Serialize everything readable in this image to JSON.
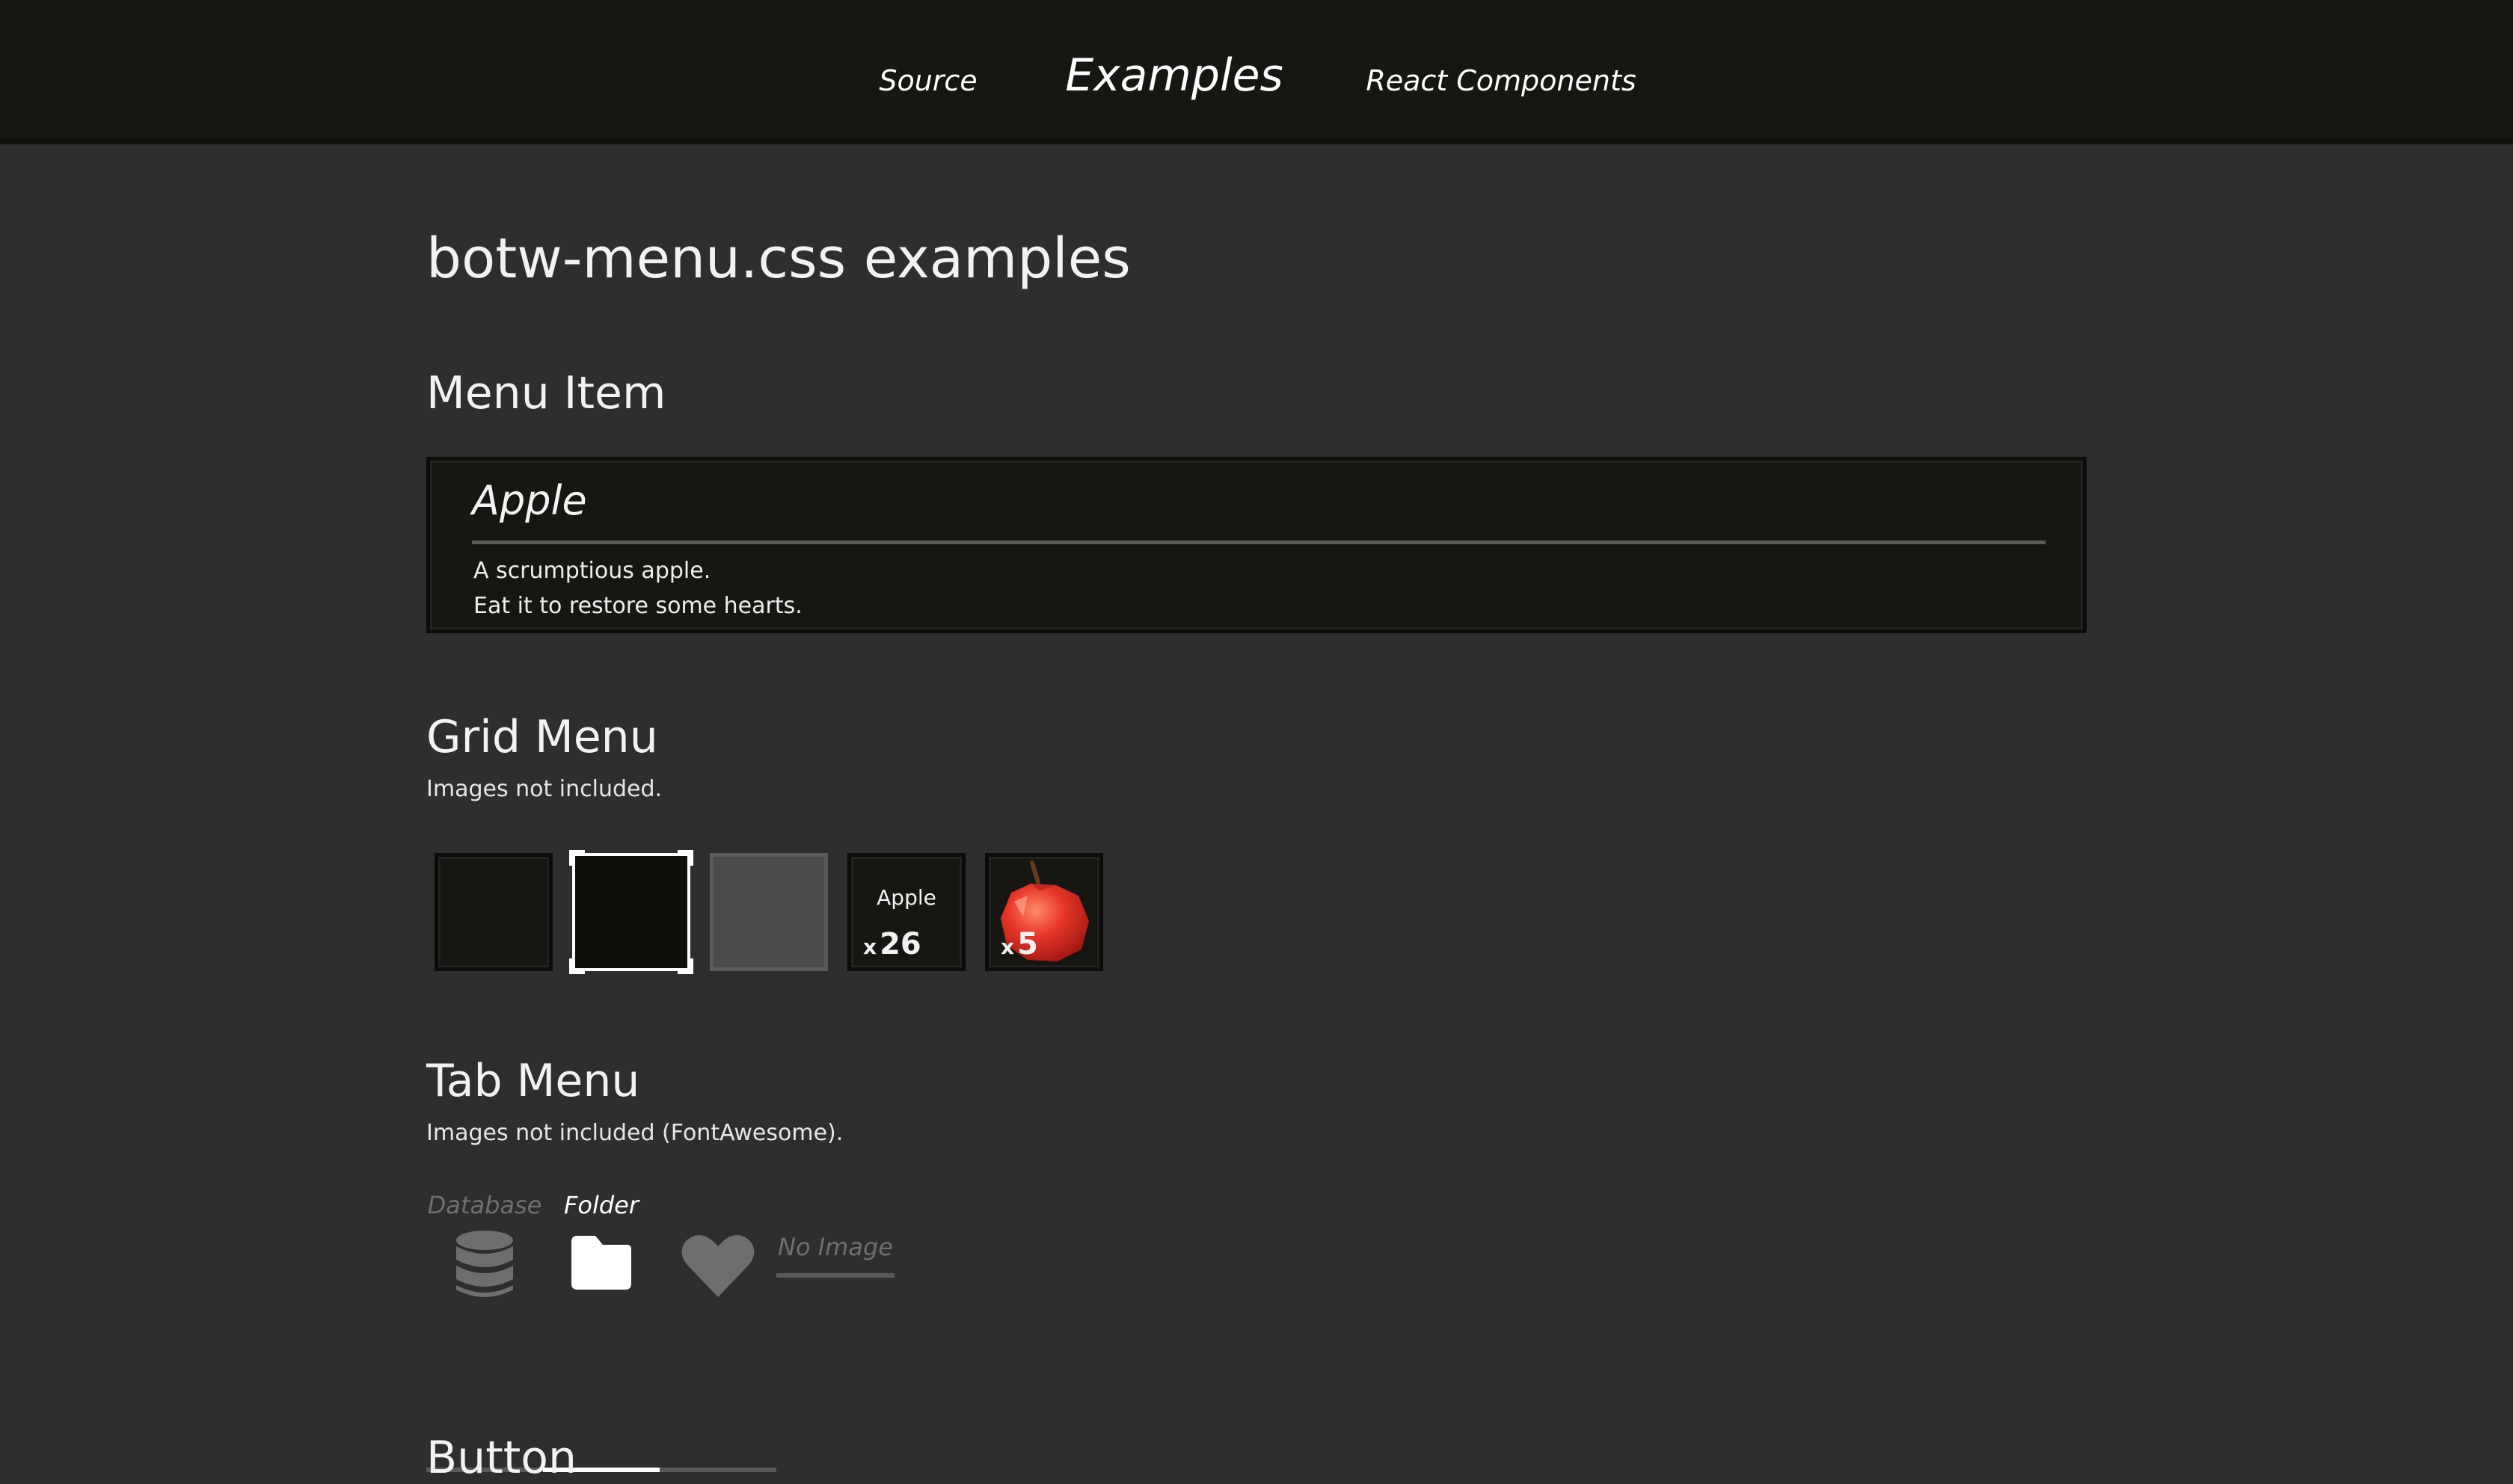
{
  "nav": {
    "source": "Source",
    "examples": "Examples",
    "react": "React Components"
  },
  "page_title": "botw-menu.css examples",
  "menu_item_section": {
    "title": "Menu Item",
    "item": {
      "name": "Apple",
      "desc_line1": "A scrumptious apple.",
      "desc_line2": "Eat it to restore some hearts."
    }
  },
  "grid_section": {
    "title": "Grid Menu",
    "subtitle": "Images not included.",
    "cells": [
      {
        "state": "normal"
      },
      {
        "state": "selected"
      },
      {
        "state": "disabled"
      },
      {
        "state": "named",
        "name": "Apple",
        "qty_x": "x",
        "qty": "26"
      },
      {
        "state": "image",
        "image": "apple-image",
        "qty_x": "x",
        "qty": "5"
      }
    ]
  },
  "tab_section": {
    "title": "Tab Menu",
    "subtitle": "Images not included (FontAwesome).",
    "tabs": [
      {
        "label": "Database",
        "icon": "database-icon",
        "state": "inactive"
      },
      {
        "label": "Folder",
        "icon": "folder-icon",
        "state": "active"
      },
      {
        "label": "",
        "icon": "heart-icon",
        "state": "inactive"
      },
      {
        "label": "No Image",
        "icon": "",
        "state": "inactive"
      }
    ]
  },
  "button_section": {
    "title": "Button"
  },
  "colors": {
    "page_bg": "#2e2e2e",
    "nav_bg": "#161613",
    "panel_bg": "#161613",
    "text": "#ffffff",
    "muted": "#7a7a7a"
  }
}
